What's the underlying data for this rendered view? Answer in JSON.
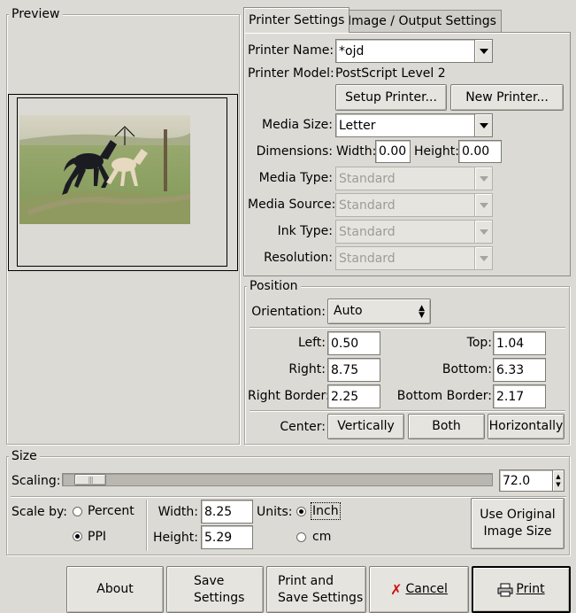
{
  "preview": {
    "title": "Preview"
  },
  "tabs": [
    {
      "label": "Printer Settings",
      "active": true
    },
    {
      "label": "Image / Output Settings",
      "active": false
    }
  ],
  "printer": {
    "name_label": "Printer Name:",
    "name_value": "*ojd",
    "model_label": "Printer Model:",
    "model_value": "PostScript Level 2",
    "setup_button": "Setup Printer...",
    "new_button": "New Printer...",
    "media_size_label": "Media Size:",
    "media_size_value": "Letter",
    "dimensions_label": "Dimensions:",
    "width_label": "Width:",
    "width_value": "0.00",
    "height_label": "Height:",
    "height_value": "0.00",
    "media_type_label": "Media Type:",
    "media_type_value": "Standard",
    "media_source_label": "Media Source:",
    "media_source_value": "Standard",
    "ink_type_label": "Ink Type:",
    "ink_type_value": "Standard",
    "resolution_label": "Resolution:",
    "resolution_value": "Standard"
  },
  "position": {
    "title": "Position",
    "orientation_label": "Orientation:",
    "orientation_value": "Auto",
    "left_label": "Left:",
    "left_value": "0.50",
    "top_label": "Top:",
    "top_value": "1.04",
    "right_label": "Right:",
    "right_value": "8.75",
    "bottom_label": "Bottom:",
    "bottom_value": "6.33",
    "right_border_label": "Right Border:",
    "right_border_value": "2.25",
    "bottom_border_label": "Bottom Border:",
    "bottom_border_value": "2.17",
    "center_label": "Center:",
    "vertically": "Vertically",
    "both": "Both",
    "horizontally": "Horizontally"
  },
  "size": {
    "title": "Size",
    "scaling_label": "Scaling:",
    "scaling_value": "72.0",
    "scaling_level": 0.03,
    "scale_by_label": "Scale by:",
    "percent_label": "Percent",
    "ppi_label": "PPI",
    "width_label": "Width:",
    "width_value": "8.25",
    "height_label": "Height:",
    "height_value": "5.29",
    "units_label": "Units:",
    "inch_label": "Inch",
    "cm_label": "cm",
    "use_original_line1": "Use Original",
    "use_original_line2": "Image Size"
  },
  "footer": {
    "about": "About",
    "save_line1": "Save",
    "save_line2": "Settings",
    "print_save_line1": "Print and",
    "print_save_line2": "Save Settings",
    "cancel": "Cancel",
    "print": "Print"
  },
  "colors": {
    "cancel_icon": "#cc1010",
    "accent": "#dcdad5"
  }
}
